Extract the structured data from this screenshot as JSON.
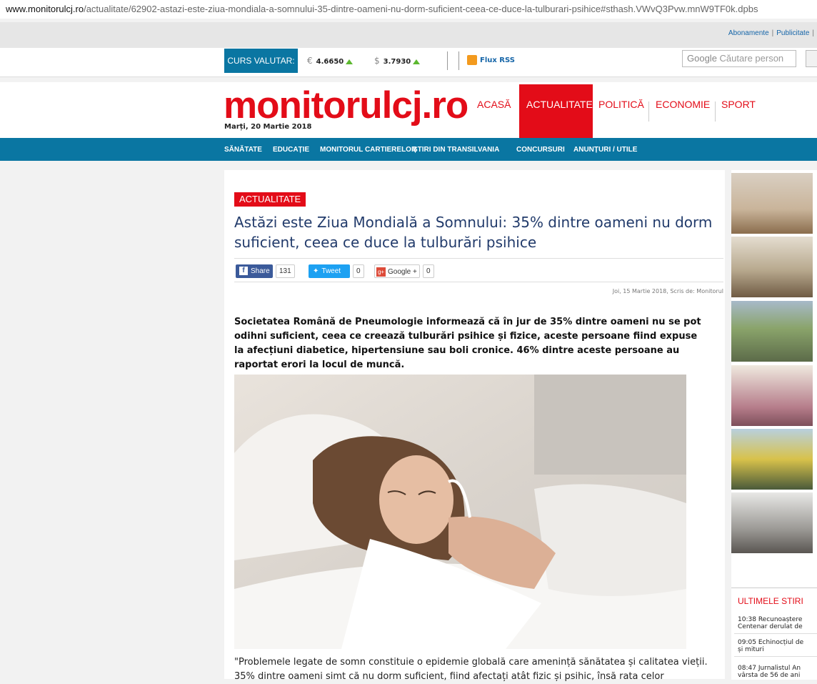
{
  "browser": {
    "url_host": "www.monitorulcj.ro",
    "url_path": "/actualitate/62902-astazi-este-ziua-mondiala-a-somnului-35-dintre-oameni-nu-dorm-suficient-ceea-ce-duce-la-tulburari-psihice#sthash.VWvQ3Pvw.mnW9TF0k.dpbs"
  },
  "top_links": {
    "abonamente": "Abonamente",
    "separator": "|",
    "publicitate": "Publicitate"
  },
  "currency": {
    "label": "CURS VALUTAR:",
    "eur_symbol": "€",
    "eur_value": "4.6650",
    "usd_symbol": "$",
    "usd_value": "3.7930"
  },
  "rss": {
    "label": "Flux RSS"
  },
  "search": {
    "google": "Google",
    "placeholder": "Căutare person"
  },
  "logo": {
    "text": "monitorulcj.ro",
    "date": "Marți, 20 Martie 2018"
  },
  "nav": {
    "items": [
      "ACASĂ",
      "ACTUALITATE",
      "POLITICĂ",
      "ECONOMIE",
      "SPORT"
    ]
  },
  "subnav": {
    "items": [
      "SĂNĂTATE",
      "EDUCAȚIE",
      "MONITORUL CARTIERELOR",
      "ȘTIRI DIN TRANSILVANIA",
      "CONCURSURI",
      "ANUNȚURI / UTILE"
    ]
  },
  "article": {
    "tag": "ACTUALITATE",
    "title": "Astăzi este Ziua Mondială a Somnului: 35% dintre oameni nu dorm suficient, ceea ce duce la tulburări psihice",
    "share": {
      "facebook_label": "Share",
      "facebook_count": "131",
      "tweet_label": "Tweet",
      "tweet_count": "0",
      "gplus_label": "Google +",
      "gplus_count": "0"
    },
    "meta": "Joi, 15 Martie 2018, Scris de: Monitorul",
    "lead": "Societatea Română de Pneumologie informează că în jur de 35% dintre oameni nu se pot odihni suficient, ceea ce creează tulburări psihice și fizice, aceste persoane fiind expuse la afecțiuni diabetice, hipertensiune sau boli cronice. 46% dintre aceste persoane au raportat erori la locul de muncă.",
    "body": "\"Problemele legate de somn constituie o epidemie globală care amenință sănătatea și calitatea vieții. 35% dintre oameni simt că nu dorm suficient, fiind afectați atât fizic și psihic, însă rata celor"
  },
  "sidebar": {
    "ultimele_title": "ULTIMELE STIRI",
    "items": [
      {
        "time": "10:38",
        "line1": "Recunoaștere",
        "line2": "Centenar derulat de"
      },
      {
        "time": "09:05",
        "line1": "Echinocțiul de",
        "line2": "și mituri"
      },
      {
        "time": "08:47",
        "line1": "Jurnalistul An",
        "line2": "vârsta de 56 de ani"
      }
    ]
  }
}
